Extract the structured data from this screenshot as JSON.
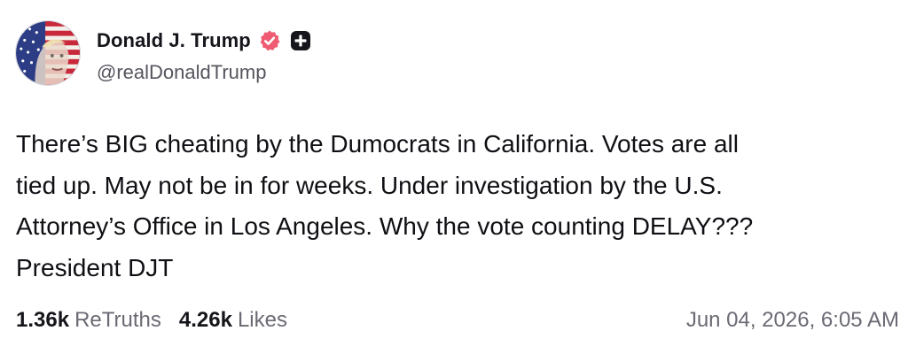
{
  "author": {
    "display_name": "Donald J. Trump",
    "handle": "@realDonaldTrump",
    "avatar_icon": "flag-portrait-avatar",
    "verified_icon": "verified-badge-icon",
    "verified_color": "#ef5b73",
    "plus_icon": "plus-badge-icon"
  },
  "post": {
    "lines": [
      "There’s BIG cheating by the Dumocrats in California. Votes are all",
      "tied up. May not be in for weeks. Under investigation by the U.S.",
      "Attorney’s Office in Los Angeles. Why the vote counting DELAY???",
      "President DJT"
    ]
  },
  "stats": {
    "retruths_count": "1.36k",
    "retruths_label": "ReTruths",
    "likes_count": "4.26k",
    "likes_label": "Likes"
  },
  "timestamp": "Jun 04, 2026, 6:05 AM"
}
